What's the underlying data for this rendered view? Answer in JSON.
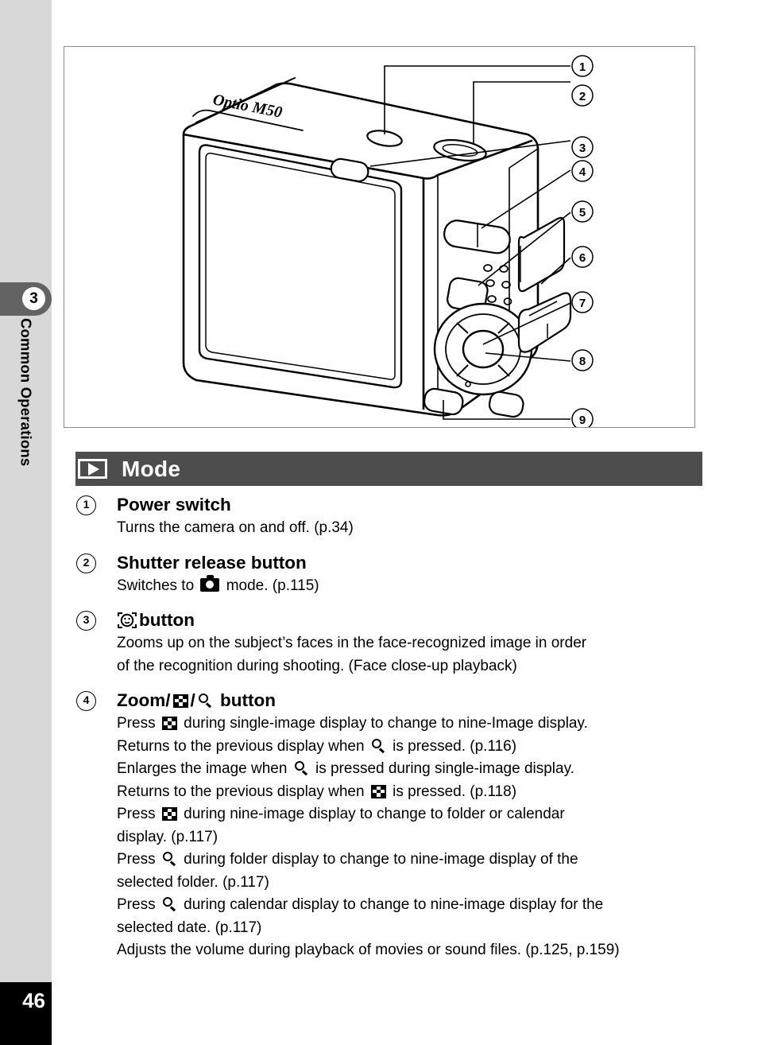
{
  "sidebar": {
    "chapter_number": "3",
    "chapter_label": "Common Operations",
    "page_number": "46"
  },
  "figure": {
    "name": "camera-rear-view-illustration",
    "model_text": "Optio M50",
    "callouts": [
      "1",
      "2",
      "3",
      "4",
      "5",
      "6",
      "7",
      "8",
      "9"
    ]
  },
  "section": {
    "icon": "playback-mode-icon",
    "title": "Mode"
  },
  "items": [
    {
      "number": "1",
      "title": "Power switch",
      "title_icons": [],
      "body": [
        "Turns the camera on and off. (p.34)"
      ]
    },
    {
      "number": "2",
      "title": "Shutter release button",
      "title_icons": [],
      "body_pre": "Switches to",
      "body_post": "mode. (p.115)",
      "body_icon": "capture-mode-camera-icon"
    },
    {
      "number": "3",
      "title": "button",
      "title_icon": "face-detection-icon",
      "body": [
        "Zooms up on the subject’s faces in the face-recognized image in order",
        "of the recognition during shooting. (Face close-up playback)"
      ]
    },
    {
      "number": "4",
      "title_prefix": "Zoom/",
      "title_sep": "/",
      "title_suffix": "button",
      "title_icon_left": "nine-image-display-icon",
      "title_icon_right": "magnify-icon",
      "lines": [
        {
          "pre": "Press",
          "icon": "nine-image-display-icon",
          "post": "during single-image display to change to nine-Image display."
        },
        {
          "pre": "Returns to the previous display when",
          "icon": "magnify-icon",
          "post": "is pressed. (p.116)"
        },
        {
          "pre": "Enlarges the image when",
          "icon": "magnify-icon",
          "post": "is pressed during single-image display."
        },
        {
          "pre": "Returns to the previous display when",
          "icon": "nine-image-display-icon",
          "post": "is pressed. (p.118)"
        },
        {
          "pre": "Press",
          "icon": "nine-image-display-icon",
          "post": "during nine-image display to change to folder or calendar"
        },
        {
          "plain": "display. (p.117)"
        },
        {
          "pre": "Press",
          "icon": "magnify-icon",
          "post": "during folder display to change to nine-image display of the"
        },
        {
          "plain": "selected folder. (p.117)"
        },
        {
          "pre": "Press",
          "icon": "magnify-icon",
          "post": "during calendar display to change to nine-image display for the"
        },
        {
          "plain": "selected date. (p.117)"
        },
        {
          "plain": "Adjusts the volume during playback of movies or sound files. (p.125, p.159)"
        }
      ]
    }
  ],
  "colors": {
    "rail_gray": "#d8d8d8",
    "tab_gray": "#636363",
    "bar_gray": "#4d4d4d",
    "figure_border": "#8b8b8b",
    "page_block": "#000000"
  }
}
